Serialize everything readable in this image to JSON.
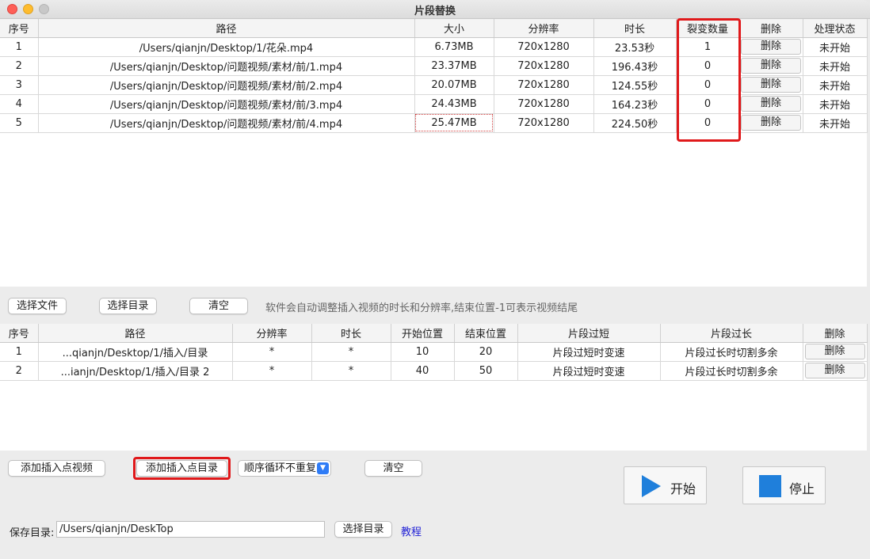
{
  "window": {
    "title": "片段替换"
  },
  "top_table": {
    "headers": [
      "序号",
      "路径",
      "大小",
      "分辨率",
      "时长",
      "裂变数量",
      "删除",
      "处理状态"
    ],
    "rows": [
      {
        "index": "1",
        "path": "/Users/qianjn/Desktop/1/花朵.mp4",
        "size": "6.73MB",
        "resolution": "720x1280",
        "duration": "23.53秒",
        "count": "1",
        "delete": "删除",
        "status": "未开始"
      },
      {
        "index": "2",
        "path": "/Users/qianjn/Desktop/问题视频/素材/前/1.mp4",
        "size": "23.37MB",
        "resolution": "720x1280",
        "duration": "196.43秒",
        "count": "0",
        "delete": "删除",
        "status": "未开始"
      },
      {
        "index": "3",
        "path": "/Users/qianjn/Desktop/问题视频/素材/前/2.mp4",
        "size": "20.07MB",
        "resolution": "720x1280",
        "duration": "124.55秒",
        "count": "0",
        "delete": "删除",
        "status": "未开始"
      },
      {
        "index": "4",
        "path": "/Users/qianjn/Desktop/问题视频/素材/前/3.mp4",
        "size": "24.43MB",
        "resolution": "720x1280",
        "duration": "164.23秒",
        "count": "0",
        "delete": "删除",
        "status": "未开始"
      },
      {
        "index": "5",
        "path": "/Users/qianjn/Desktop/问题视频/素材/前/4.mp4",
        "size": "25.47MB",
        "resolution": "720x1280",
        "duration": "224.50秒",
        "count": "0",
        "delete": "删除",
        "status": "未开始"
      }
    ]
  },
  "file_toolbar": {
    "select_file": "选择文件",
    "select_dir": "选择目录",
    "clear": "清空",
    "hint": "软件会自动调整插入视频的时长和分辨率,结束位置-1可表示视频结尾"
  },
  "insert_table": {
    "headers": [
      "序号",
      "路径",
      "分辨率",
      "时长",
      "开始位置",
      "结束位置",
      "片段过短",
      "片段过长",
      "删除"
    ],
    "rows": [
      {
        "index": "1",
        "path": "...qianjn/Desktop/1/插入/目录",
        "resolution": "*",
        "duration": "*",
        "start": "10",
        "end": "20",
        "short": "片段过短时变速",
        "long": "片段过长时切割多余",
        "delete": "删除"
      },
      {
        "index": "2",
        "path": "...ianjn/Desktop/1/插入/目录 2",
        "resolution": "*",
        "duration": "*",
        "start": "40",
        "end": "50",
        "short": "片段过短时变速",
        "long": "片段过长时切割多余",
        "delete": "删除"
      }
    ]
  },
  "insert_toolbar": {
    "add_video": "添加插入点视频",
    "add_dir": "添加插入点目录",
    "order_select": "顺序循环不重复",
    "clear": "清空"
  },
  "controls": {
    "start": "开始",
    "stop": "停止"
  },
  "save": {
    "label": "保存目录:",
    "path": "/Users/qianjn/DeskTop",
    "select_dir": "选择目录",
    "tutorial": "教程"
  },
  "colors": {
    "highlight": "#e0191b",
    "accent": "#1f7fdb",
    "link": "#2323d6"
  }
}
